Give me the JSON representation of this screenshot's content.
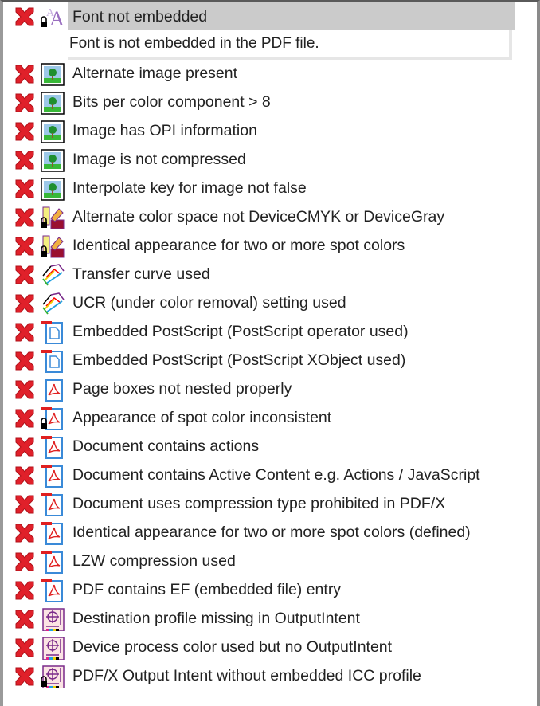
{
  "colors": {
    "error": "#e0202a",
    "selected_bg": "#cbcbcb"
  },
  "selected": {
    "label": "Font not embedded",
    "icon": "font-icon",
    "lock": true,
    "detail": "Font is not embedded in the PDF file."
  },
  "items": [
    {
      "label": "Alternate image present",
      "icon": "image-icon",
      "lock": false
    },
    {
      "label": "Bits per color component > 8",
      "icon": "image-icon",
      "lock": false
    },
    {
      "label": "Image has OPI information",
      "icon": "image-icon",
      "lock": false
    },
    {
      "label": "Image is not compressed",
      "icon": "image-icon",
      "lock": false
    },
    {
      "label": "Interpolate key for image not false",
      "icon": "image-icon",
      "lock": false
    },
    {
      "label": "Alternate color space not DeviceCMYK or DeviceGray",
      "icon": "colorspace-icon",
      "lock": true
    },
    {
      "label": "Identical appearance for two or more spot colors",
      "icon": "colorspace-icon",
      "lock": true
    },
    {
      "label": "Transfer curve used",
      "icon": "curve-icon",
      "lock": false
    },
    {
      "label": "UCR (under color removal) setting used",
      "icon": "curve-icon",
      "lock": false
    },
    {
      "label": "Embedded PostScript (PostScript operator used)",
      "icon": "postscript-icon",
      "lock": false
    },
    {
      "label": "Embedded PostScript (PostScript XObject used)",
      "icon": "postscript-icon",
      "lock": false
    },
    {
      "label": "Page boxes not nested properly",
      "icon": "pdf-icon",
      "lock": false,
      "tab": false
    },
    {
      "label": "Appearance of spot color inconsistent",
      "icon": "pdf-icon",
      "lock": true,
      "tab": true
    },
    {
      "label": "Document contains actions",
      "icon": "pdf-icon",
      "lock": false,
      "tab": true
    },
    {
      "label": "Document contains Active Content e.g. Actions / JavaScript",
      "icon": "pdf-icon",
      "lock": false,
      "tab": true
    },
    {
      "label": "Document uses compression type prohibited in PDF/X",
      "icon": "pdf-icon",
      "lock": false,
      "tab": true
    },
    {
      "label": "Identical appearance for two or more spot colors (defined)",
      "icon": "pdf-icon",
      "lock": false,
      "tab": true
    },
    {
      "label": "LZW compression used",
      "icon": "pdf-icon",
      "lock": false,
      "tab": true
    },
    {
      "label": "PDF contains EF (embedded file) entry",
      "icon": "pdf-icon",
      "lock": false,
      "tab": true
    },
    {
      "label": "Destination profile missing in OutputIntent",
      "icon": "output-intent-icon",
      "lock": false
    },
    {
      "label": "Device process color used but no OutputIntent",
      "icon": "output-intent-icon",
      "lock": false
    },
    {
      "label": "PDF/X Output Intent without embedded ICC profile",
      "icon": "output-intent-icon",
      "lock": true
    }
  ]
}
